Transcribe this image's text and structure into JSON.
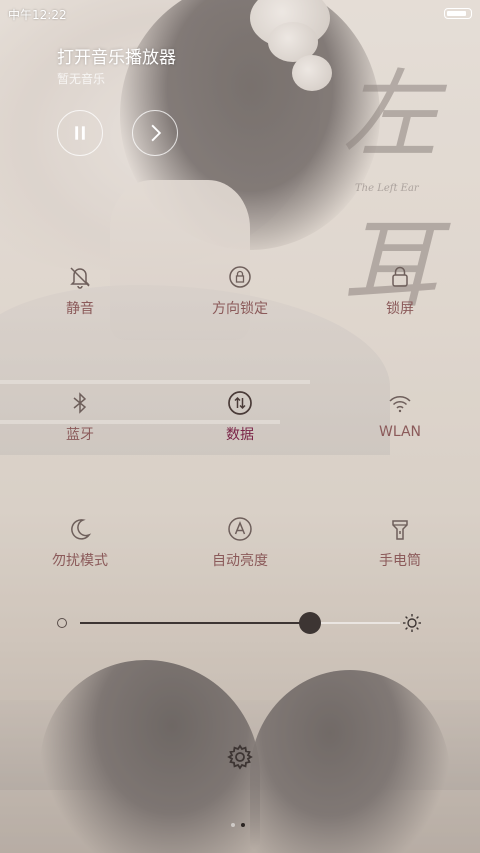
{
  "status": {
    "time": "中午12:22",
    "battery_level": 0.9
  },
  "music": {
    "title": "打开音乐播放器",
    "subtitle": "暂无音乐",
    "pause_icon": "pause-icon",
    "next_icon": "chevron-right-icon"
  },
  "wallpaper": {
    "calligraphy": "左耳",
    "caption": "The Left Ear"
  },
  "toggles": [
    {
      "id": "mute",
      "label": "静音",
      "icon": "bell-off-icon",
      "active": false
    },
    {
      "id": "rotation-lock",
      "label": "方向锁定",
      "icon": "rotation-lock-icon",
      "active": false
    },
    {
      "id": "lock-screen",
      "label": "锁屏",
      "icon": "lock-icon",
      "active": false
    },
    {
      "id": "bluetooth",
      "label": "蓝牙",
      "icon": "bluetooth-icon",
      "active": false
    },
    {
      "id": "data",
      "label": "数据",
      "icon": "data-arrows-icon",
      "active": true
    },
    {
      "id": "wlan",
      "label": "WLAN",
      "icon": "wifi-icon",
      "active": false
    },
    {
      "id": "dnd",
      "label": "勿扰模式",
      "icon": "moon-icon",
      "active": false
    },
    {
      "id": "auto-brightness",
      "label": "自动亮度",
      "icon": "auto-a-icon",
      "active": false
    },
    {
      "id": "flashlight",
      "label": "手电筒",
      "icon": "flashlight-icon",
      "active": false
    }
  ],
  "brightness": {
    "level": 0.72
  },
  "pager": {
    "pages": 2,
    "current": 2
  },
  "colors": {
    "label": "#8b5a5a",
    "label_active": "#7a2447",
    "icon": "#6e5f5b"
  }
}
